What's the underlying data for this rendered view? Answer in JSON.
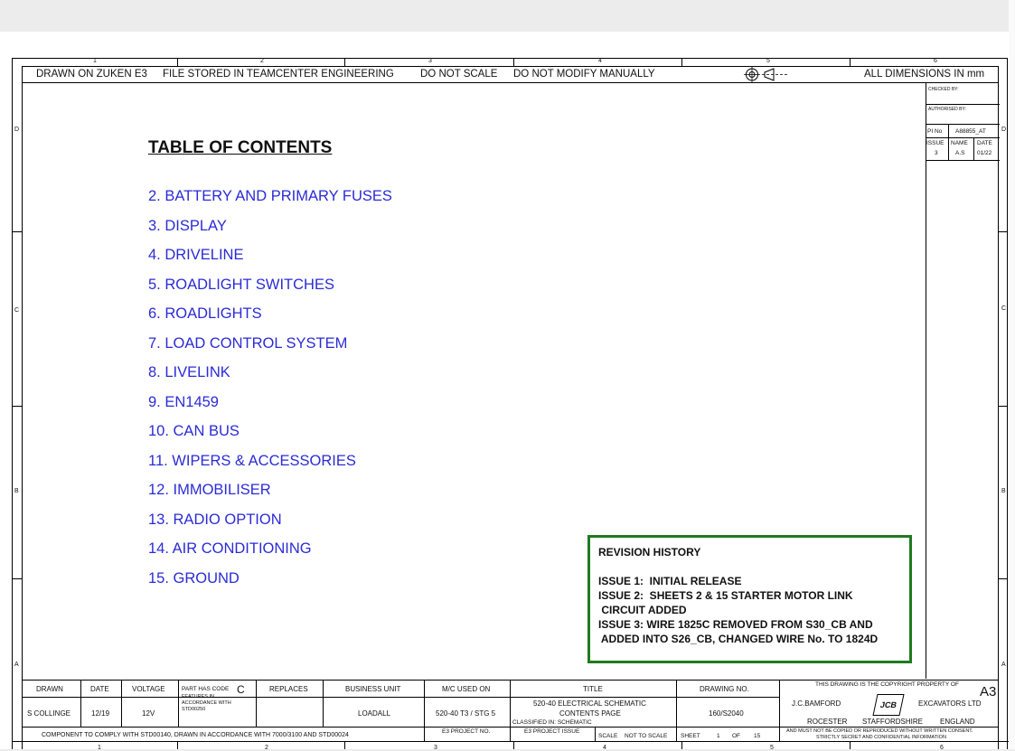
{
  "header": {
    "drawn_on": "DRAWN ON ZUKEN E3",
    "file_stored": "FILE STORED IN TEAMCENTER ENGINEERING",
    "do_not_scale": "DO NOT SCALE",
    "do_not_modify": "DO NOT MODIFY MANUALLY",
    "dimensions": "ALL DIMENSIONS IN mm"
  },
  "zones": {
    "columns": [
      "1",
      "2",
      "3",
      "4",
      "5",
      "6"
    ],
    "rows": [
      "D",
      "C",
      "B",
      "A"
    ]
  },
  "toc": {
    "title": "TABLE OF CONTENTS",
    "items": [
      "2. BATTERY AND PRIMARY FUSES",
      "3. DISPLAY",
      "4. DRIVELINE",
      "5. ROADLIGHT SWITCHES",
      "6. ROADLIGHTS",
      "7. LOAD CONTROL SYSTEM",
      "8. LIVELINK",
      "9. EN1459",
      "10. CAN BUS",
      "11. WIPERS & ACCESSORIES",
      "12. IMMOBILISER",
      "13. RADIO OPTION",
      "14. AIR CONDITIONING",
      "15. GROUND"
    ]
  },
  "revision_history": {
    "title": "REVISION HISTORY",
    "lines": [
      "ISSUE 1:  INITIAL RELEASE",
      "ISSUE 2:  SHEETS 2 & 15 STARTER MOTOR LINK",
      " CIRCUIT ADDED",
      "ISSUE 3: WIRE 1825C REMOVED FROM S30_CB AND",
      " ADDED INTO S26_CB, CHANGED WIRE No. TO 1824D"
    ]
  },
  "side_panel": {
    "checked_by": "CHECKED BY:",
    "authorised_by": "AUTHORISED BY:",
    "pi_no_label": "PI No",
    "pi_no_value": "A88855_AT",
    "issue_label": "ISSUE",
    "name_label": "NAME",
    "date_label": "DATE",
    "issue_value": "3",
    "name_value": "A.S",
    "date_value": "01/22"
  },
  "title_block": {
    "drawn_label": "DRAWN",
    "drawn_value": "S COLLINGE",
    "date_label": "DATE",
    "date_value": "12/19",
    "voltage_label": "VOLTAGE",
    "voltage_value": "12V",
    "part_code_label": "PART HAS CODE",
    "part_code_value": "C",
    "features_text": "FEATURES IN ACCORDANCE WITH STD00250",
    "replaces_label": "REPLACES",
    "business_unit_label": "BUSINESS UNIT",
    "business_unit_value": "LOADALL",
    "mc_used_on_label": "M/C USED ON",
    "mc_used_on_value": "520-40 T3 / STG 5",
    "title_label": "TITLE",
    "title_line1": "520-40 ELECTRICAL SCHEMATIC",
    "title_line2": "CONTENTS PAGE",
    "classified": "CLASSIFIED IN:  SCHEMATIC",
    "drawing_no_label": "DRAWING NO.",
    "drawing_no_value": "160/S2040",
    "copyright": "THIS DRAWING IS THE COPYRIGHT PROPERTY OF",
    "size": "A3",
    "company_left": "J.C.BAMFORD",
    "company_right": "EXCAVATORS LTD",
    "logo_text": "JCB",
    "address_1": "ROCESTER",
    "address_2": "STAFFORDSHIRE",
    "address_3": "ENGLAND",
    "confidential_1": "AND MUST NOT BE COPIED OR REPRODUCED WITHOUT WRITTEN CONSENT.",
    "confidential_2": "STRICTLY SECRET AND CONFIDENTIAL INFORMATION",
    "compliance": "COMPONENT TO COMPLY WITH STD00140, DRAWN IN ACCORDANCE WITH 7000/3100 AND STD00024",
    "e3_project_no": "E3 PROJECT NO.",
    "e3_project_issue": "E3 PROJECT ISSUE",
    "scale_label": "SCALE",
    "scale_value": "NOT TO SCALE",
    "sheet_label": "SHEET",
    "sheet_value": "1",
    "of_label": "OF",
    "of_value": "15"
  }
}
